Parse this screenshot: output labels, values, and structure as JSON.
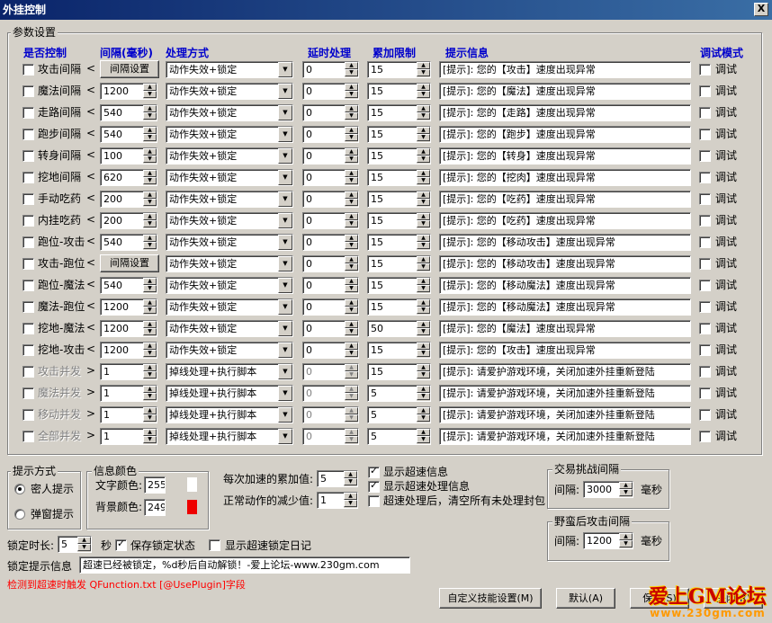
{
  "window": {
    "title": "外挂控制",
    "close_glyph": "X"
  },
  "params_group": {
    "title": "参数设置"
  },
  "headers": {
    "control": "是否控制",
    "interval": "间隔(毫秒)",
    "method": "处理方式",
    "delay": "延时处理",
    "limit": "累加限制",
    "hint": "提示信息",
    "debug": "调试模式"
  },
  "rows": [
    {
      "label": "攻击间隔",
      "arrow": "<",
      "interval": null,
      "interval_btn": "间隔设置",
      "method": "动作失效+锁定",
      "delay": "0",
      "limit": "15",
      "hint": "[提示]: 您的【攻击】速度出现异常",
      "debug": "调试",
      "disabled": false
    },
    {
      "label": "魔法间隔",
      "arrow": "<",
      "interval": "1200",
      "method": "动作失效+锁定",
      "delay": "0",
      "limit": "15",
      "hint": "[提示]: 您的【魔法】速度出现异常",
      "debug": "调试",
      "disabled": false
    },
    {
      "label": "走路间隔",
      "arrow": "<",
      "interval": "540",
      "method": "动作失效+锁定",
      "delay": "0",
      "limit": "15",
      "hint": "[提示]: 您的【走路】速度出现异常",
      "debug": "调试",
      "disabled": false
    },
    {
      "label": "跑步间隔",
      "arrow": "<",
      "interval": "540",
      "method": "动作失效+锁定",
      "delay": "0",
      "limit": "15",
      "hint": "[提示]: 您的【跑步】速度出现异常",
      "debug": "调试",
      "disabled": false
    },
    {
      "label": "转身间隔",
      "arrow": "<",
      "interval": "100",
      "method": "动作失效+锁定",
      "delay": "0",
      "limit": "15",
      "hint": "[提示]: 您的【转身】速度出现异常",
      "debug": "调试",
      "disabled": false
    },
    {
      "label": "挖地间隔",
      "arrow": "<",
      "interval": "620",
      "method": "动作失效+锁定",
      "delay": "0",
      "limit": "15",
      "hint": "[提示]: 您的【挖肉】速度出现异常",
      "debug": "调试",
      "disabled": false
    },
    {
      "label": "手动吃药",
      "arrow": "<",
      "interval": "200",
      "method": "动作失效+锁定",
      "delay": "0",
      "limit": "15",
      "hint": "[提示]: 您的【吃药】速度出现异常",
      "debug": "调试",
      "disabled": false
    },
    {
      "label": "内挂吃药",
      "arrow": "<",
      "interval": "200",
      "method": "动作失效+锁定",
      "delay": "0",
      "limit": "15",
      "hint": "[提示]: 您的【吃药】速度出现异常",
      "debug": "调试",
      "disabled": false
    },
    {
      "label": "跑位-攻击",
      "arrow": "<",
      "interval": "540",
      "method": "动作失效+锁定",
      "delay": "0",
      "limit": "15",
      "hint": "[提示]: 您的【移动攻击】速度出现异常",
      "debug": "调试",
      "disabled": false
    },
    {
      "label": "攻击-跑位",
      "arrow": "<",
      "interval": null,
      "interval_btn": "间隔设置",
      "method": "动作失效+锁定",
      "delay": "0",
      "limit": "15",
      "hint": "[提示]: 您的【移动攻击】速度出现异常",
      "debug": "调试",
      "disabled": false
    },
    {
      "label": "跑位-魔法",
      "arrow": "<",
      "interval": "540",
      "method": "动作失效+锁定",
      "delay": "0",
      "limit": "15",
      "hint": "[提示]: 您的【移动魔法】速度出现异常",
      "debug": "调试",
      "disabled": false
    },
    {
      "label": "魔法-跑位",
      "arrow": "<",
      "interval": "1200",
      "method": "动作失效+锁定",
      "delay": "0",
      "limit": "15",
      "hint": "[提示]: 您的【移动魔法】速度出现异常",
      "debug": "调试",
      "disabled": false
    },
    {
      "label": "挖地-魔法",
      "arrow": "<",
      "interval": "1200",
      "method": "动作失效+锁定",
      "delay": "0",
      "limit": "50",
      "hint": "[提示]: 您的【魔法】速度出现异常",
      "debug": "调试",
      "disabled": false
    },
    {
      "label": "挖地-攻击",
      "arrow": "<",
      "interval": "1200",
      "method": "动作失效+锁定",
      "delay": "0",
      "limit": "15",
      "hint": "[提示]: 您的【攻击】速度出现异常",
      "debug": "调试",
      "disabled": false
    },
    {
      "label": "攻击并发",
      "arrow": ">",
      "interval": "1",
      "method": "掉线处理+执行脚本",
      "delay": "0",
      "limit": "15",
      "hint": "[提示]: 请爱护游戏环境，关闭加速外挂重新登陆",
      "debug": "调试",
      "disabled": true
    },
    {
      "label": "魔法并发",
      "arrow": ">",
      "interval": "1",
      "method": "掉线处理+执行脚本",
      "delay": "0",
      "limit": "5",
      "hint": "[提示]: 请爱护游戏环境，关闭加速外挂重新登陆",
      "debug": "调试",
      "disabled": true
    },
    {
      "label": "移动并发",
      "arrow": ">",
      "interval": "1",
      "method": "掉线处理+执行脚本",
      "delay": "0",
      "limit": "5",
      "hint": "[提示]: 请爱护游戏环境，关闭加速外挂重新登陆",
      "debug": "调试",
      "disabled": true
    },
    {
      "label": "全部并发",
      "arrow": ">",
      "interval": "1",
      "method": "掉线处理+执行脚本",
      "delay": "0",
      "limit": "5",
      "hint": "[提示]: 请爱护游戏环境，关闭加速外挂重新登陆",
      "debug": "调试",
      "disabled": true
    }
  ],
  "prompt_mode": {
    "title": "提示方式",
    "option1": "密人提示",
    "option2": "弹窗提示",
    "selected": "密人提示"
  },
  "info_color": {
    "title": "信息颜色",
    "text_label": "文字颜色:",
    "text_value": "255",
    "text_swatch": "#ffffff",
    "bg_label": "背景颜色:",
    "bg_value": "249",
    "bg_swatch": "#ee0000"
  },
  "accel": {
    "accum_label": "每次加速的累加值:",
    "accum_value": "5",
    "reduce_label": "正常动作的减少值:",
    "reduce_value": "1"
  },
  "options": {
    "show_speed": "显示超速信息",
    "show_speed_checked": true,
    "show_handling": "显示超速处理信息",
    "show_handling_checked": true,
    "clear_packets": "超速处理后，清空所有未处理封包",
    "clear_packets_checked": false
  },
  "trade_group": {
    "title": "交易挑战间隔",
    "interval_label": "间隔:",
    "value": "3000",
    "unit": "毫秒"
  },
  "savage_group": {
    "title": "野蛮后攻击间隔",
    "interval_label": "间隔:",
    "value": "1200",
    "unit": "毫秒"
  },
  "lock": {
    "duration_label": "锁定时长:",
    "duration_value": "5",
    "unit": "秒",
    "save_state": "保存锁定状态",
    "save_state_checked": true,
    "show_log": "显示超速锁定日记",
    "show_log_checked": false
  },
  "lock_hint": {
    "label": "锁定提示信息",
    "value": "超速已经被锁定，%d秒后自动解锁！-爱上论坛-www.230gm.com"
  },
  "trigger_note": "检测到超速时触发 QFunction.txt [@UsePlugin]字段",
  "buttons": {
    "custom_skill": "自定义技能设置(M)",
    "default": "默认(A)",
    "save": "保存(S)",
    "close": "关闭(R)"
  },
  "watermark": {
    "line1": "爱上GM论坛",
    "line2": "www.230gm.com"
  }
}
